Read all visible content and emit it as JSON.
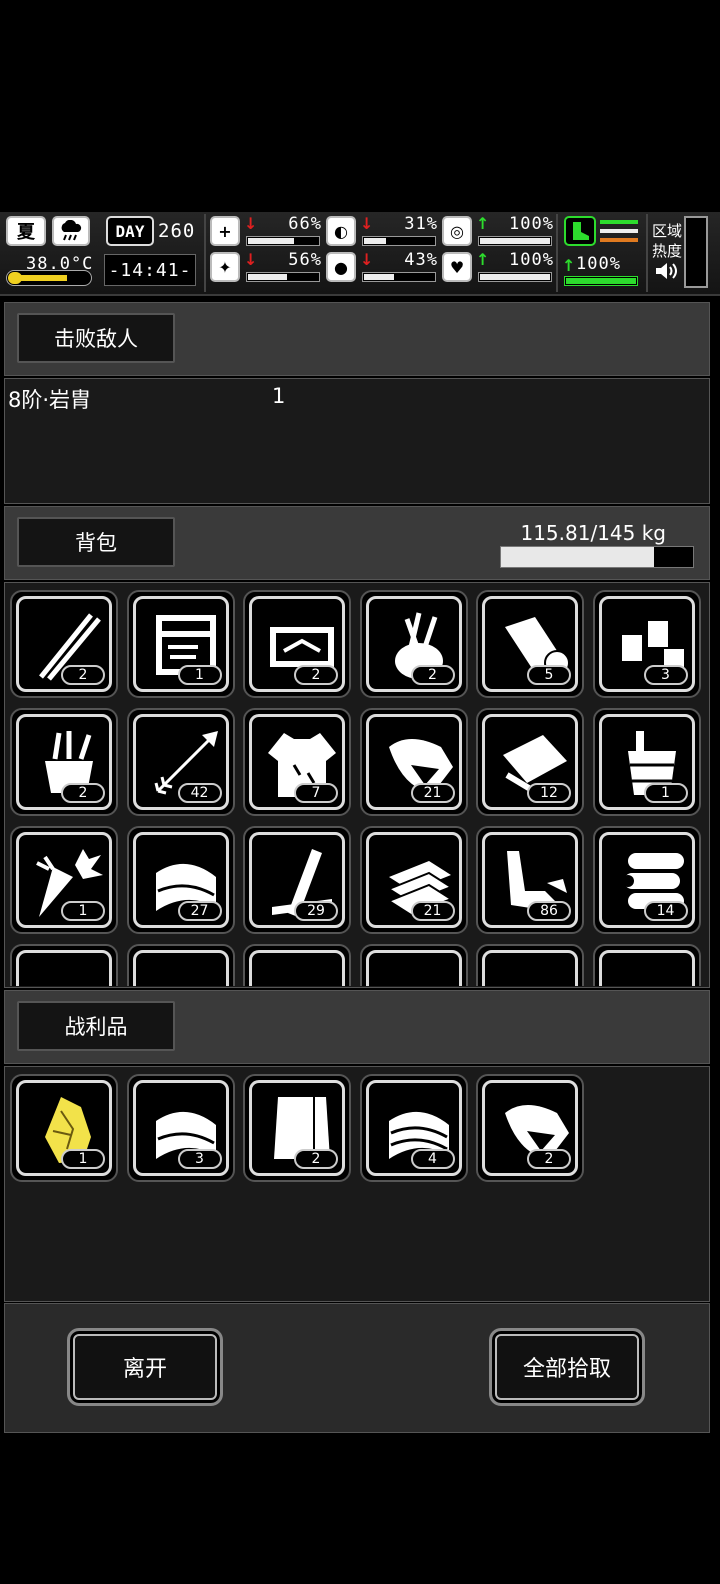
{
  "hud": {
    "season": "夏",
    "temperature": "38.0°C",
    "day_label": "DAY",
    "day": "260",
    "time": "-14:41-",
    "stats": [
      {
        "name": "health",
        "icon": "medkit-icon",
        "value": "66%",
        "trend": "down",
        "level": 0.66
      },
      {
        "name": "hunger",
        "icon": "stomach-icon",
        "value": "31%",
        "trend": "down",
        "level": 0.31
      },
      {
        "name": "stamina",
        "icon": "pill-icon",
        "value": "100%",
        "trend": "up",
        "level": 1.0
      },
      {
        "name": "sanity",
        "icon": "brain-icon",
        "value": "56%",
        "trend": "down",
        "level": 0.56
      },
      {
        "name": "thirst",
        "icon": "water-drop-icon",
        "value": "43%",
        "trend": "down",
        "level": 0.43
      },
      {
        "name": "mood",
        "icon": "heart-icon",
        "value": "100%",
        "trend": "up",
        "level": 1.0
      }
    ],
    "boot_value": "100%",
    "region_label_1": "区域",
    "region_label_2": "热度"
  },
  "defeated": {
    "tab_label": "击败敌人",
    "enemy_name": "8阶·岩胄",
    "enemy_count": "1"
  },
  "backpack": {
    "tab_label": "背包",
    "weight_text": "115.81/145 kg",
    "weight_level": 0.7987,
    "items": [
      {
        "icon": "tweezers-icon",
        "count": "2"
      },
      {
        "icon": "toolbox-icon",
        "count": "1"
      },
      {
        "icon": "repair-kit-icon",
        "count": "2"
      },
      {
        "icon": "tool-pot-icon",
        "count": "2"
      },
      {
        "icon": "bandage-roll-icon",
        "count": "5"
      },
      {
        "icon": "jars-icon",
        "count": "3"
      },
      {
        "icon": "tool-bucket-icon",
        "count": "2"
      },
      {
        "icon": "arrow-icon",
        "count": "42"
      },
      {
        "icon": "torn-shirt-icon",
        "count": "7"
      },
      {
        "icon": "meat-icon",
        "count": "21"
      },
      {
        "icon": "cloth-scraps-icon",
        "count": "12"
      },
      {
        "icon": "wooden-bucket-icon",
        "count": "1"
      },
      {
        "icon": "carrot-icon",
        "count": "1"
      },
      {
        "icon": "folded-cloth-icon",
        "count": "27"
      },
      {
        "icon": "planks-icon",
        "count": "29"
      },
      {
        "icon": "stone-slabs-icon",
        "count": "21"
      },
      {
        "icon": "scrap-pieces-icon",
        "count": "86"
      },
      {
        "icon": "logs-icon",
        "count": "14"
      },
      {
        "icon": "box-icon",
        "count": ""
      },
      {
        "icon": "crate-icon",
        "count": ""
      },
      {
        "icon": "chest-icon",
        "count": ""
      },
      {
        "icon": "bottle-icon",
        "count": ""
      },
      {
        "icon": "pile-icon",
        "count": ""
      },
      {
        "icon": "rope-icon",
        "count": ""
      }
    ]
  },
  "loot": {
    "tab_label": "战利品",
    "items": [
      {
        "icon": "gold-ore-icon",
        "count": "1",
        "color": "#f2e24a"
      },
      {
        "icon": "folded-cloth-icon",
        "count": "3"
      },
      {
        "icon": "cloth-sheet-icon",
        "count": "2"
      },
      {
        "icon": "folded-cloth-stack-icon",
        "count": "4"
      },
      {
        "icon": "meat-icon",
        "count": "2"
      }
    ]
  },
  "buttons": {
    "leave": "离开",
    "take_all": "全部拾取"
  }
}
